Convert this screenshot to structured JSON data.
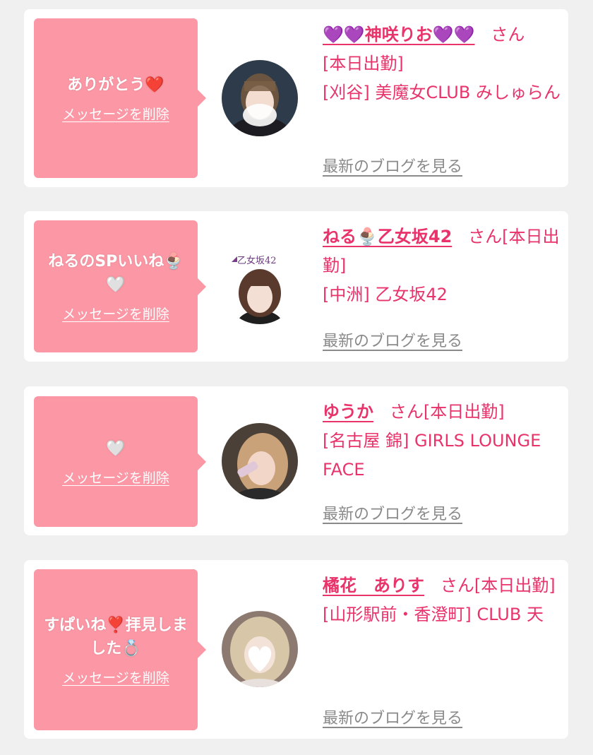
{
  "entries": [
    {
      "message": "ありがとう❤️",
      "delete_label": "メッセージを削除",
      "name": "💜💜神咲りお💜💜",
      "honorific": "さん",
      "status": "[本日出勤]",
      "shop": "[刈谷] 美魔女CLUB みしゅらん",
      "blog_label": "最新のブログを見る"
    },
    {
      "message": "ねるのSPいいね🍨🤍",
      "delete_label": "メッセージを削除",
      "name": "ねる🍨乙女坂42",
      "honorific": "さん",
      "status": "[本日出勤]",
      "shop": "[中洲] 乙女坂42",
      "blog_label": "最新のブログを見る",
      "avatar_logo": "乙女坂42"
    },
    {
      "message": "🤍",
      "delete_label": "メッセージを削除",
      "name": "ゆうか",
      "honorific": "さん",
      "status": "[本日出勤]",
      "shop": "[名古屋 錦] GIRLS LOUNGE FACE",
      "blog_label": "最新のブログを見る"
    },
    {
      "message": "すぱいね❣️拝見しました💍",
      "delete_label": "メッセージを削除",
      "name": "橘花　ありす",
      "honorific": "さん",
      "status": "[本日出勤]",
      "shop": "[山形駅前・香澄町] CLUB 天",
      "blog_label": "最新のブログを見る"
    }
  ],
  "colors": {
    "bubble": "#fc97a5",
    "accent": "#e8336b",
    "link_gray": "#8a8a8a",
    "background": "#f0f0f0"
  }
}
